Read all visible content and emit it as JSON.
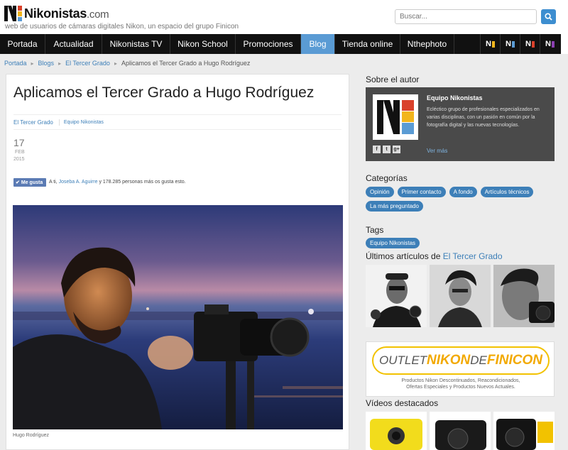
{
  "header": {
    "logo_name": "Nikonistas",
    "logo_domain": ".com",
    "tagline": "web de usuarios de cámaras digitales Nikon, un espacio del grupo Finicon",
    "search_placeholder": "Buscar..."
  },
  "nav": {
    "items": [
      "Portada",
      "Actualidad",
      "Nikonistas TV",
      "Nikon School",
      "Promociones",
      "Blog",
      "Tienda online",
      "Nthephoto"
    ],
    "active": "Blog",
    "logo_marks": [
      "N",
      "N",
      "N",
      "N"
    ]
  },
  "breadcrumb": {
    "items": [
      "Portada",
      "Blogs",
      "El Tercer Grado"
    ],
    "current": "Aplicamos el Tercer Grado a Hugo Rodríguez"
  },
  "article": {
    "title": "Aplicamos el Tercer Grado a Hugo Rodríguez",
    "category": "El Tercer Grado",
    "author": "Equipo Nikonistas",
    "date_day": "17",
    "date_month": "FEB",
    "date_year": "2015",
    "like_label": "Me gusta",
    "like_prefix": "A ti, ",
    "like_person": "Joseba A. Aguirre",
    "like_suffix": " y 178.285 personas más os gusta esto.",
    "photo_caption": "Hugo Rodríguez"
  },
  "sidebar": {
    "about_heading": "Sobre el autor",
    "author_name": "Equipo Nikonistas",
    "author_desc": "Ecléctico grupo de profesionales especializados en varias disciplinas, con un pasión en común por la fotografía digital y las nuevas tecnologías.",
    "author_more": "Ver más",
    "social": [
      "f",
      "t",
      "g+"
    ],
    "categories_heading": "Categorías",
    "categories": [
      "Opinión",
      "Primer contacto",
      "A fondo",
      "Artículos técnicos",
      "La más preguntado"
    ],
    "tags_heading": "Tags",
    "tags": [
      "Equipo Nikonistas"
    ],
    "latest_prefix": "Últimos artículos de ",
    "latest_link": "El Tercer Grado",
    "ad_word1": "OUTLET ",
    "ad_word2": "NIKON",
    "ad_word3": " DE ",
    "ad_word4": "FINICON",
    "ad_line1": "Productos Nikon Descontinuados, Reacondicionados,",
    "ad_line2": "Ofertas Especiales y Productos Nuevos Actuales.",
    "videos_heading": "Vídeos destacados"
  },
  "colors": {
    "accent": "#3d7fb8",
    "nav_bg": "#111111",
    "nav_active": "#5a9bd4",
    "logo_red": "#d9412b",
    "logo_yellow": "#f2b51c",
    "logo_blue": "#5a9bd4"
  }
}
